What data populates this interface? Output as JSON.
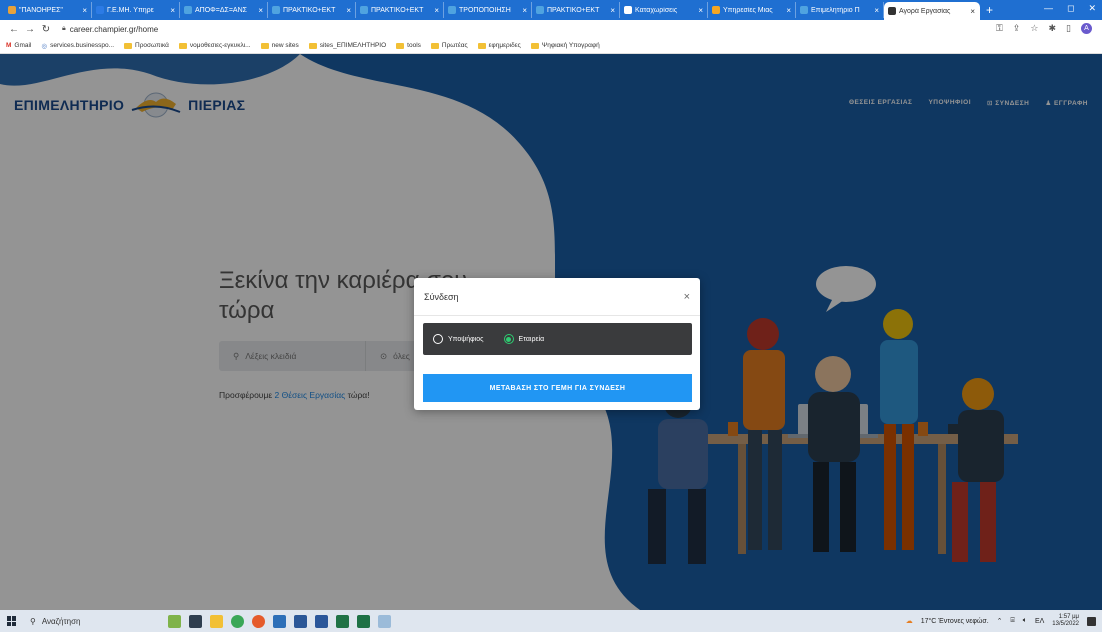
{
  "browser": {
    "tabs": [
      {
        "label": "\"ΠΑΝΟΗΡΕΣ\"",
        "fav": "#e6a23c"
      },
      {
        "label": "Γ.Ε.ΜΗ. Υπηρε",
        "fav": "#2c7be5"
      },
      {
        "label": "ΑΠΟΦ=ΔΣ=ΑΝΣ",
        "fav": "#4fa3e0"
      },
      {
        "label": "ΠΡΑΚΤΙΚΟ+ΕΚΤ",
        "fav": "#4fa3e0"
      },
      {
        "label": "ΠΡΑΚΤΙΚΟ+ΕΚΤ",
        "fav": "#4fa3e0"
      },
      {
        "label": "ΤΡΟΠΟΠΟΙΗΣΗ",
        "fav": "#4fa3e0"
      },
      {
        "label": "ΠΡΑΚΤΙΚΟ+ΕΚΤ",
        "fav": "#4fa3e0"
      },
      {
        "label": "Καταχωρίσεις",
        "fav": "#ffffff"
      },
      {
        "label": "Υπηρεσίες Μιας",
        "fav": "#f5a623"
      },
      {
        "label": "Επιμελητήριο Π",
        "fav": "#4fa3e0"
      },
      {
        "label": "Αγορά Εργασίας",
        "fav": "#333333",
        "active": true
      }
    ],
    "new_tab": "+",
    "url": "career.champier.gr/home",
    "profile_initial": "A",
    "bookmarks": [
      "Gmail",
      "services.businesspo...",
      "Προσωπικά",
      "νομοθεσιες-εγκυκλι...",
      "new sites",
      "sites_ΕΠΙΜΕΛΗΤΗΡΙΟ",
      "tools",
      "Πρωτέας",
      "εφημεριδες",
      "Ψηφιακή Υπογραφή"
    ]
  },
  "site": {
    "logo_left": "ΕΠΙΜΕΛΗΤΗΡΙΟ",
    "logo_right": "ΠΙΕΡΙΑΣ",
    "nav": [
      "ΘΕΣΕΙΣ ΕΡΓΑΣΙΑΣ",
      "ΥΠΟΨΗΦΙΟΙ",
      "⊡ ΣΥΝΔΕΣΗ",
      "♟ ΕΓΓΡΑΦΗ"
    ],
    "hero_line1": "Ξεκίνα την καριέρα σου",
    "hero_line2": "τώρα",
    "search_placeholder": "Λέξεις κλειδιά",
    "location_placeholder": "όλες",
    "offer_prefix": "Προσφέρουμε",
    "offer_link": "2 Θέσεις Εργασίας",
    "offer_suffix": "τώρα!"
  },
  "modal": {
    "title": "Σύνδεση",
    "close": "×",
    "option_candidate": "Υποψήφιος",
    "option_company": "Εταιρεία",
    "selected": "company",
    "button": "ΜΕΤΑΒΑΣΗ ΣΤΟ ΓΕΜΗ ΓΙΑ ΣΥΝΔΕΣΗ"
  },
  "taskbar": {
    "search_label": "Αναζήτηση",
    "weather": "17°C Έντονες νεφώσ.",
    "lang": "ΕΛ",
    "time": "1:57 μμ",
    "date": "13/5/2022"
  },
  "colors": {
    "brand_blue": "#1a5fa8",
    "button_blue": "#2196f3",
    "radio_green": "#2ecc71",
    "link_blue": "#1e88e5"
  }
}
